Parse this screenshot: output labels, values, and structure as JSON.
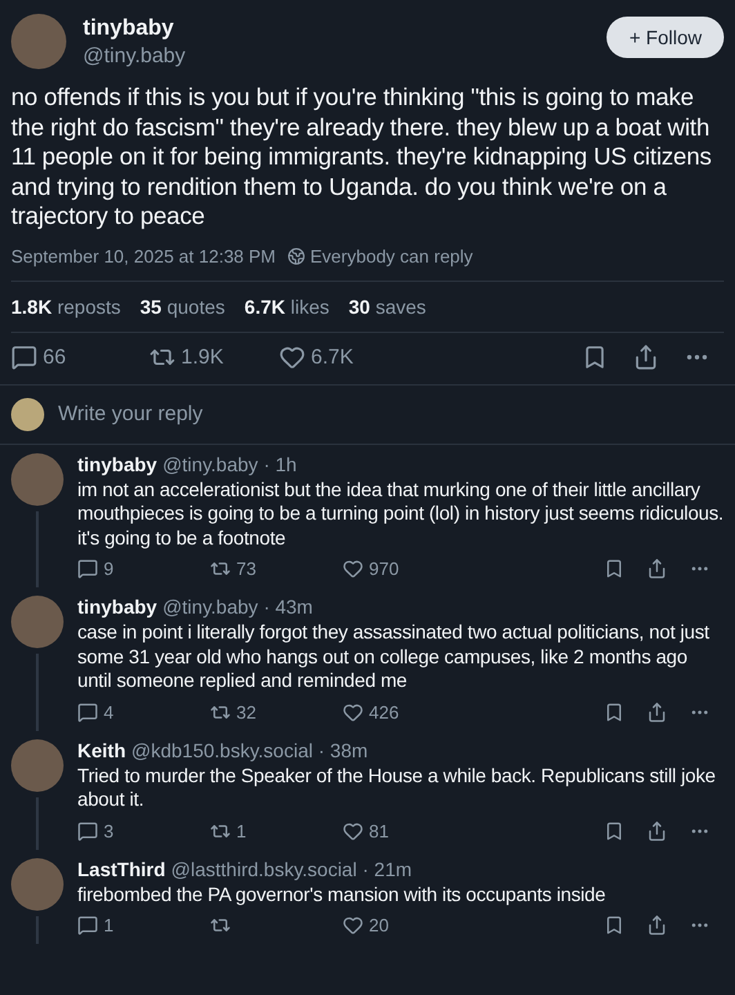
{
  "post": {
    "display_name": "tinybaby",
    "handle": "@tiny.baby",
    "follow_button": "+ Follow",
    "text": "no offends if this is you but if you're thinking \"this is going to make the right do fascism\" they're already there. they blew up a boat with 11 people on it for being immigrants. they're kidnapping US citizens and trying to rendition them to Uganda. do you think we're on a trajectory to peace",
    "timestamp": "September 10, 2025 at 12:38 PM",
    "reply_setting": "Everybody can reply",
    "stats": [
      {
        "count": "1.8K",
        "label": "reposts"
      },
      {
        "count": "35",
        "label": "quotes"
      },
      {
        "count": "6.7K",
        "label": "likes"
      },
      {
        "count": "30",
        "label": "saves"
      }
    ],
    "actions": {
      "replies": "66",
      "reposts": "1.9K",
      "likes": "6.7K"
    }
  },
  "reply_box": {
    "placeholder": "Write your reply"
  },
  "replies": [
    {
      "display_name": "tinybaby",
      "handle": "@tiny.baby",
      "time": "· 1h",
      "text": "im not an accelerationist but the idea that murking one of their little ancillary mouthpieces is going to be a turning point (lol) in history just seems ridiculous. it's going to be a footnote",
      "replies": "9",
      "reposts": "73",
      "likes": "970"
    },
    {
      "display_name": "tinybaby",
      "handle": "@tiny.baby",
      "time": "· 43m",
      "text": "case in point i literally forgot they assassinated two actual politicians, not just some 31 year old who hangs out on college campuses, like 2 months ago until someone replied and reminded me",
      "replies": "4",
      "reposts": "32",
      "likes": "426"
    },
    {
      "display_name": "Keith",
      "handle": "@kdb150.bsky.social",
      "time": "· 38m",
      "text": "Tried to murder the Speaker of the House a while back. Republicans still joke about it.",
      "replies": "3",
      "reposts": "1",
      "likes": "81"
    },
    {
      "display_name": "LastThird",
      "handle": "@lastthird.bsky.social",
      "time": "· 21m",
      "text": "firebombed the PA governor's mansion with its occupants inside",
      "replies": "1",
      "likes": "20"
    }
  ]
}
